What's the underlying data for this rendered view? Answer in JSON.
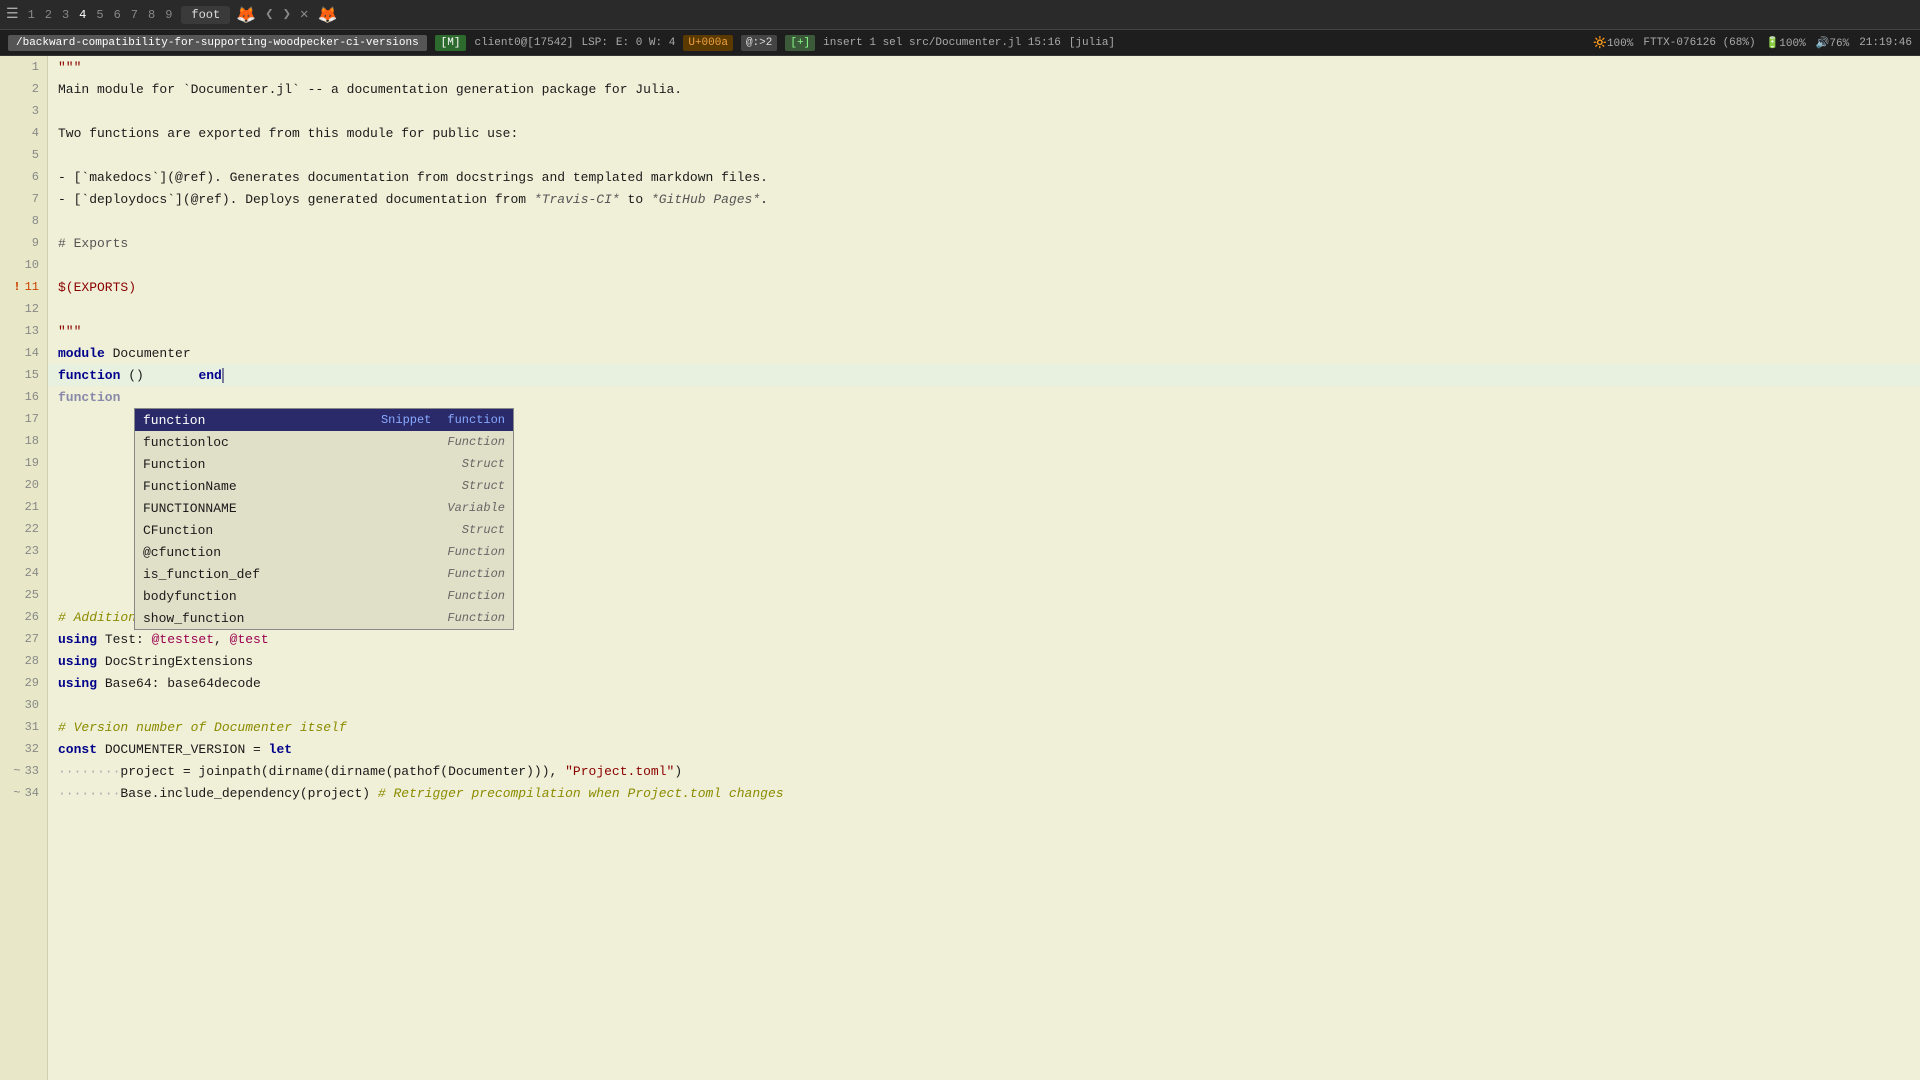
{
  "topbar": {
    "menu_icon": "☰",
    "tabs": [
      "1",
      "2",
      "3",
      "4",
      "5",
      "6",
      "7",
      "8",
      "9"
    ],
    "active_tab": "4",
    "file_label": "foot",
    "firefox_icon": "🦊",
    "btn1": "❮",
    "btn2": "❯",
    "btn3": "✕",
    "btn4": "🦊"
  },
  "statusbar": {
    "branch": "/backward-compatibility-for-supporting-woodpecker-ci-versions",
    "mode_indicator": "[M]",
    "client": "client0@[17542]",
    "lsp": "LSP:",
    "errors": "E: 0 W: 4",
    "undo": "U+000a",
    "macro": "@:>2",
    "new_file": "[+]",
    "insert_info": "insert 1 sel src/Documenter.jl 15:16",
    "lang": "[julia]",
    "brightness": "🔆100%",
    "font": "FTTX-076126 (68%)",
    "battery": "🔋100%",
    "volume": "🔊76%",
    "time": "21:19:46"
  },
  "lines": [
    {
      "num": "1",
      "content": "\"\"\"",
      "type": "string"
    },
    {
      "num": "2",
      "content": "Main module for `Documenter.jl` -- a documentation generation package for Julia.",
      "type": "normal"
    },
    {
      "num": "3",
      "content": "",
      "type": "normal"
    },
    {
      "num": "4",
      "content": "Two functions are exported from this module for public use:",
      "type": "normal"
    },
    {
      "num": "5",
      "content": "",
      "type": "normal"
    },
    {
      "num": "6",
      "content": "- [`makedocs`](@ref). Generates documentation from docstrings and templated markdown files.",
      "type": "normal"
    },
    {
      "num": "7",
      "content": "- [`deploydocs`](@ref). Deploys generated documentation from *Travis-CI* to *GitHub Pages*.",
      "type": "normal"
    },
    {
      "num": "8",
      "content": "",
      "type": "normal"
    },
    {
      "num": "9",
      "content": "# Exports",
      "type": "heading"
    },
    {
      "num": "10",
      "content": "",
      "type": "normal"
    },
    {
      "num": "11",
      "content": "$(EXPORTS)",
      "type": "exports",
      "warn": true
    },
    {
      "num": "12",
      "content": "",
      "type": "normal"
    },
    {
      "num": "13",
      "content": "\"\"\"",
      "type": "string"
    },
    {
      "num": "14",
      "content": "module Documenter",
      "type": "module"
    },
    {
      "num": "15",
      "content": "function ()       end",
      "type": "function_line"
    },
    {
      "num": "16",
      "content": "function",
      "type": "ac_trigger"
    },
    {
      "num": "17",
      "content": "functionloc",
      "type": "ac_item"
    },
    {
      "num": "18",
      "content": "Function",
      "type": "ac_item"
    },
    {
      "num": "19",
      "content": "FunctionName",
      "type": "ac_item"
    },
    {
      "num": "20",
      "content": "FUNCTIONNAME",
      "type": "ac_item"
    },
    {
      "num": "21",
      "content": "CFunction",
      "type": "ac_item"
    },
    {
      "num": "22",
      "content": "@cfunction",
      "type": "ac_item"
    },
    {
      "num": "23",
      "content": "is_function_def",
      "type": "ac_item"
    },
    {
      "num": "24",
      "content": "bodyfunction",
      "type": "ac_item"
    },
    {
      "num": "25",
      "content": "show_function",
      "type": "ac_item"
    },
    {
      "num": "26",
      "content": "# Additional imported names",
      "type": "comment"
    },
    {
      "num": "27",
      "content": "using Test: @testset, @test",
      "type": "using"
    },
    {
      "num": "28",
      "content": "using DocStringExtensions",
      "type": "using"
    },
    {
      "num": "29",
      "content": "using Base64: base64decode",
      "type": "using"
    },
    {
      "num": "30",
      "content": "",
      "type": "normal"
    },
    {
      "num": "31",
      "content": "# Version number of Documenter itself",
      "type": "comment"
    },
    {
      "num": "32",
      "content": "const DOCUMENTER_VERSION = let",
      "type": "const"
    },
    {
      "num": "33",
      "content": "········project = joinpath(dirname(dirname(pathof(Documenter))), \"Project.toml\")",
      "type": "dots",
      "tilde": true
    },
    {
      "num": "34",
      "content": "········Base.include_dependency(project) # Retrigger precompilation when Project.toml changes",
      "type": "dots",
      "tilde": true
    }
  ],
  "autocomplete": {
    "items": [
      {
        "name": "function",
        "type": "Snippet",
        "type_label": "function",
        "selected": true
      },
      {
        "name": "functionloc",
        "type": "Function",
        "type_label": "Function",
        "selected": false
      },
      {
        "name": "Function",
        "type": "Struct",
        "type_label": "Struct",
        "selected": false
      },
      {
        "name": "FunctionName",
        "type": "Struct",
        "type_label": "Struct",
        "selected": false
      },
      {
        "name": "FUNCTIONNAME",
        "type": "Variable",
        "type_label": "Variable",
        "selected": false
      },
      {
        "name": "CFunction",
        "type": "Struct",
        "type_label": "Struct",
        "selected": false
      },
      {
        "name": "@cfunction",
        "type": "Function",
        "type_label": "Function",
        "selected": false
      },
      {
        "name": "is_function_def",
        "type": "Function",
        "type_label": "Function",
        "selected": false
      },
      {
        "name": "bodyfunction",
        "type": "Function",
        "type_label": "Function",
        "selected": false
      },
      {
        "name": "show_function",
        "type": "Function",
        "type_label": "Function",
        "selected": false
      }
    ]
  }
}
